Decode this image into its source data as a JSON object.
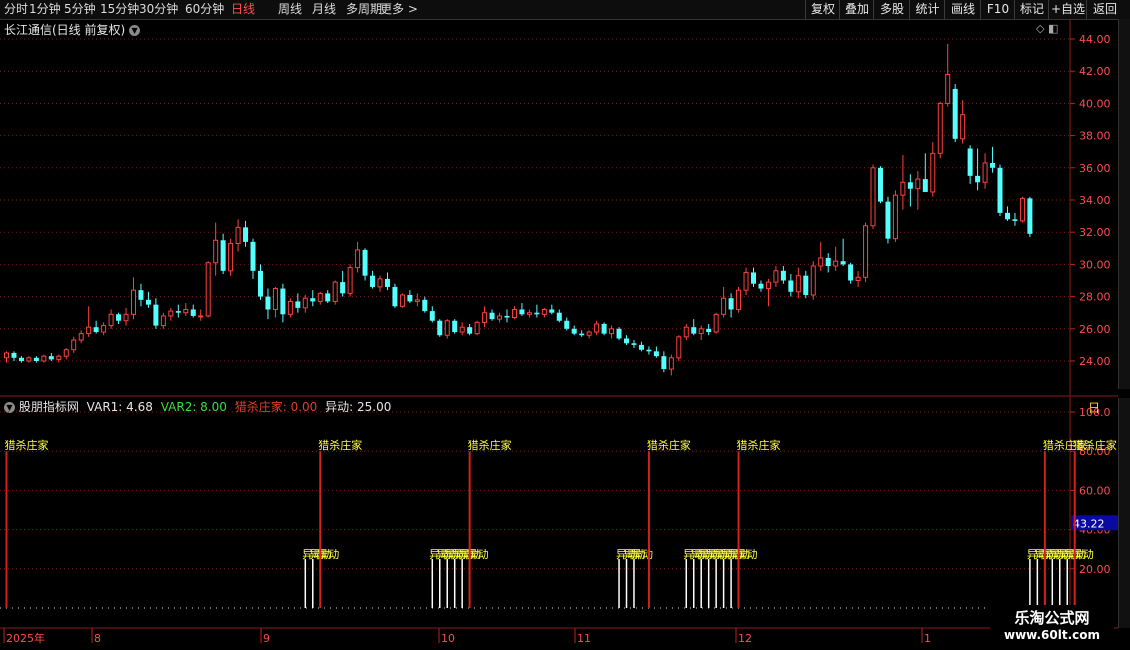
{
  "toolbar": {
    "periods": [
      "分时",
      "1分钟",
      "5分钟",
      "15分钟",
      "30分钟",
      "60分钟",
      "日线",
      "周线",
      "月线",
      "多周期",
      "更多 >"
    ],
    "active_period": "日线",
    "tools": [
      "复权",
      "叠加",
      "多股",
      "统计",
      "画线",
      "F10",
      "标记",
      "+自选",
      "返回"
    ]
  },
  "main_chart": {
    "title": "长江通信(日线 前复权)",
    "y_ticks": [
      "44.00",
      "42.00",
      "40.00",
      "38.00",
      "36.00",
      "34.00",
      "32.00",
      "30.00",
      "28.00",
      "26.00",
      "24.00"
    ]
  },
  "indicator": {
    "name": "股朋指标网",
    "var1": "VAR1: 4.68",
    "var2": "VAR2: 8.00",
    "hunt": "猎杀庄家: 0.00",
    "yidong": "异动: 25.00",
    "y_ticks": [
      "100.0",
      "80.00",
      "60.00",
      "40.00",
      "20.00"
    ],
    "current_value": "43.22",
    "right_label": "日",
    "label_hunt": "猎杀庄家",
    "label_move": "异动"
  },
  "time_axis": [
    "2025年",
    "8",
    "9",
    "10",
    "11",
    "12",
    "1"
  ],
  "watermark": {
    "line1": "乐淘公式网",
    "line2": "www.60lt.com"
  },
  "colors": {
    "up": "#ff4040",
    "down": "#54ffff",
    "signal": "#d81e1e",
    "label": "#ffff3c",
    "grid": "#7a1a1a",
    "active": "#ff4c4c"
  },
  "chart_data": {
    "type": "candlestick",
    "ylim": [
      23,
      44.5
    ],
    "candles_ohlc": [
      [
        24.2,
        24.6,
        23.9,
        24.5
      ],
      [
        24.5,
        24.6,
        24.0,
        24.2
      ],
      [
        24.2,
        24.3,
        23.9,
        24.0
      ],
      [
        24.0,
        24.3,
        23.9,
        24.2
      ],
      [
        24.2,
        24.3,
        23.9,
        24.0
      ],
      [
        24.0,
        24.4,
        23.9,
        24.3
      ],
      [
        24.3,
        24.5,
        24.0,
        24.1
      ],
      [
        24.1,
        24.4,
        23.9,
        24.3
      ],
      [
        24.3,
        24.8,
        24.1,
        24.7
      ],
      [
        24.7,
        25.5,
        24.5,
        25.3
      ],
      [
        25.3,
        25.9,
        25.1,
        25.7
      ],
      [
        25.7,
        27.4,
        25.5,
        26.1
      ],
      [
        26.1,
        26.5,
        25.7,
        25.8
      ],
      [
        25.8,
        26.4,
        25.6,
        26.2
      ],
      [
        26.2,
        27.2,
        26.0,
        26.9
      ],
      [
        26.9,
        27.0,
        26.3,
        26.5
      ],
      [
        26.5,
        27.3,
        26.2,
        26.9
      ],
      [
        26.9,
        29.2,
        26.6,
        28.4
      ],
      [
        28.4,
        28.8,
        27.4,
        27.8
      ],
      [
        27.8,
        28.3,
        27.3,
        27.5
      ],
      [
        27.5,
        27.9,
        26.0,
        26.2
      ],
      [
        26.2,
        27.0,
        26.0,
        26.8
      ],
      [
        26.8,
        27.3,
        26.5,
        27.1
      ],
      [
        27.1,
        27.5,
        26.7,
        27.0
      ],
      [
        27.0,
        27.6,
        26.8,
        27.2
      ],
      [
        27.2,
        27.5,
        26.7,
        26.8
      ],
      [
        26.8,
        27.2,
        26.5,
        26.8
      ],
      [
        26.8,
        30.2,
        26.7,
        30.1
      ],
      [
        30.1,
        32.6,
        29.3,
        31.5
      ],
      [
        31.5,
        31.9,
        29.4,
        29.6
      ],
      [
        29.6,
        31.6,
        29.3,
        31.3
      ],
      [
        31.3,
        32.8,
        30.8,
        32.3
      ],
      [
        32.3,
        32.7,
        31.1,
        31.4
      ],
      [
        31.4,
        31.6,
        29.1,
        29.6
      ],
      [
        29.6,
        30.0,
        27.8,
        28.0
      ],
      [
        28.0,
        28.5,
        26.6,
        27.2
      ],
      [
        27.2,
        28.6,
        26.7,
        28.5
      ],
      [
        28.5,
        28.8,
        26.4,
        26.9
      ],
      [
        26.9,
        27.9,
        26.7,
        27.7
      ],
      [
        27.7,
        28.2,
        27.0,
        27.3
      ],
      [
        27.3,
        28.1,
        27.0,
        27.9
      ],
      [
        27.9,
        28.4,
        27.4,
        27.7
      ],
      [
        27.7,
        28.3,
        27.5,
        28.2
      ],
      [
        28.2,
        28.4,
        27.6,
        27.7
      ],
      [
        27.7,
        29.0,
        27.5,
        28.9
      ],
      [
        28.9,
        29.6,
        28.0,
        28.2
      ],
      [
        28.2,
        30.0,
        28.0,
        29.8
      ],
      [
        29.8,
        31.4,
        29.5,
        30.9
      ],
      [
        30.9,
        31.0,
        29.0,
        29.3
      ],
      [
        29.3,
        29.6,
        28.5,
        28.6
      ],
      [
        28.6,
        29.3,
        28.3,
        29.1
      ],
      [
        29.1,
        29.5,
        28.4,
        28.6
      ],
      [
        28.6,
        28.8,
        27.3,
        27.4
      ],
      [
        27.4,
        28.2,
        27.3,
        28.1
      ],
      [
        28.1,
        28.4,
        27.6,
        27.7
      ],
      [
        27.7,
        28.2,
        27.4,
        27.8
      ],
      [
        27.8,
        28.0,
        27.0,
        27.1
      ],
      [
        27.1,
        27.4,
        26.4,
        26.5
      ],
      [
        26.5,
        26.6,
        25.5,
        25.6
      ],
      [
        25.6,
        26.6,
        25.4,
        26.5
      ],
      [
        26.5,
        26.6,
        25.7,
        25.8
      ],
      [
        25.8,
        26.4,
        25.6,
        26.1
      ],
      [
        26.1,
        26.3,
        25.6,
        25.7
      ],
      [
        25.7,
        26.5,
        25.6,
        26.4
      ],
      [
        26.4,
        27.4,
        26.1,
        27.0
      ],
      [
        27.0,
        27.2,
        26.5,
        26.6
      ],
      [
        26.6,
        27.0,
        26.4,
        26.8
      ],
      [
        26.8,
        27.2,
        26.4,
        26.7
      ],
      [
        26.7,
        27.4,
        26.6,
        27.2
      ],
      [
        27.2,
        27.6,
        26.8,
        26.9
      ],
      [
        26.9,
        27.2,
        26.7,
        27.0
      ],
      [
        27.0,
        27.5,
        26.7,
        26.9
      ],
      [
        26.9,
        27.3,
        26.7,
        27.2
      ],
      [
        27.2,
        27.5,
        26.9,
        27.0
      ],
      [
        27.0,
        27.2,
        26.4,
        26.5
      ],
      [
        26.5,
        26.7,
        25.9,
        26.0
      ],
      [
        26.0,
        26.2,
        25.6,
        25.7
      ],
      [
        25.7,
        25.9,
        25.5,
        25.6
      ],
      [
        25.6,
        25.9,
        25.4,
        25.8
      ],
      [
        25.8,
        26.5,
        25.6,
        26.3
      ],
      [
        26.3,
        26.4,
        25.6,
        25.7
      ],
      [
        25.7,
        26.2,
        25.4,
        26.0
      ],
      [
        26.0,
        26.1,
        25.3,
        25.4
      ],
      [
        25.4,
        25.6,
        25.0,
        25.1
      ],
      [
        25.1,
        25.3,
        24.8,
        25.0
      ],
      [
        25.0,
        25.2,
        24.6,
        24.7
      ],
      [
        24.7,
        24.9,
        24.4,
        24.6
      ],
      [
        24.6,
        24.9,
        24.2,
        24.3
      ],
      [
        24.3,
        24.6,
        23.3,
        23.5
      ],
      [
        23.5,
        24.4,
        23.1,
        24.2
      ],
      [
        24.2,
        25.6,
        24.0,
        25.5
      ],
      [
        25.5,
        26.3,
        25.3,
        26.1
      ],
      [
        26.1,
        26.6,
        25.6,
        25.7
      ],
      [
        25.7,
        26.2,
        25.3,
        26.0
      ],
      [
        26.0,
        26.3,
        25.6,
        25.8
      ],
      [
        25.8,
        27.0,
        25.7,
        26.9
      ],
      [
        26.9,
        28.6,
        26.7,
        27.9
      ],
      [
        27.9,
        28.2,
        26.7,
        27.2
      ],
      [
        27.2,
        28.6,
        27.0,
        28.4
      ],
      [
        28.4,
        29.8,
        28.1,
        29.5
      ],
      [
        29.5,
        29.8,
        28.6,
        28.8
      ],
      [
        28.8,
        29.0,
        28.3,
        28.5
      ],
      [
        28.5,
        29.1,
        27.4,
        28.9
      ],
      [
        28.9,
        29.9,
        28.6,
        29.6
      ],
      [
        29.6,
        29.9,
        28.8,
        29.0
      ],
      [
        29.0,
        29.4,
        28.0,
        28.3
      ],
      [
        28.3,
        29.8,
        27.9,
        29.3
      ],
      [
        29.3,
        29.6,
        27.9,
        28.1
      ],
      [
        28.1,
        30.2,
        27.8,
        29.9
      ],
      [
        29.9,
        31.4,
        29.6,
        30.4
      ],
      [
        30.4,
        30.7,
        29.5,
        29.9
      ],
      [
        29.9,
        31.1,
        29.6,
        30.2
      ],
      [
        30.2,
        31.6,
        29.9,
        30.0
      ],
      [
        30.0,
        30.1,
        28.8,
        29.0
      ],
      [
        29.0,
        29.6,
        28.6,
        29.2
      ],
      [
        29.2,
        32.6,
        28.9,
        32.4
      ],
      [
        32.4,
        36.2,
        32.2,
        36.0
      ],
      [
        36.0,
        36.1,
        33.8,
        33.9
      ],
      [
        33.9,
        34.2,
        31.3,
        31.6
      ],
      [
        31.6,
        34.6,
        31.4,
        34.3
      ],
      [
        34.3,
        36.8,
        33.4,
        35.1
      ],
      [
        35.1,
        35.6,
        33.6,
        34.7
      ],
      [
        34.7,
        35.8,
        33.4,
        35.3
      ],
      [
        35.3,
        36.9,
        34.9,
        34.5
      ],
      [
        34.5,
        37.6,
        34.2,
        36.9
      ],
      [
        36.9,
        40.1,
        36.6,
        40.0
      ],
      [
        40.0,
        43.7,
        39.8,
        41.8
      ],
      [
        40.9,
        41.2,
        37.6,
        37.8
      ],
      [
        37.8,
        40.2,
        37.5,
        39.3
      ],
      [
        37.2,
        37.4,
        35.0,
        35.5
      ],
      [
        35.5,
        37.2,
        34.6,
        35.1
      ],
      [
        35.1,
        36.9,
        34.7,
        36.3
      ],
      [
        36.3,
        37.3,
        35.7,
        36.0
      ],
      [
        36.0,
        36.2,
        33.0,
        33.2
      ],
      [
        33.2,
        33.6,
        32.7,
        32.8
      ],
      [
        32.8,
        33.2,
        32.4,
        32.7
      ],
      [
        32.7,
        34.2,
        32.6,
        34.1
      ],
      [
        34.1,
        34.2,
        31.7,
        31.9
      ]
    ],
    "hunt_signal_bars": [
      0,
      42,
      62,
      86,
      98,
      139,
      143
    ],
    "hunt_signal_value": 80,
    "yidong_bars": [
      40,
      41,
      42,
      57,
      58,
      59,
      60,
      61,
      62,
      82,
      83,
      84,
      91,
      92,
      93,
      94,
      95,
      96,
      97,
      98,
      137,
      138,
      139,
      140,
      141,
      142,
      143
    ],
    "yidong_value": 25,
    "ind_ylim": [
      0,
      105
    ]
  }
}
